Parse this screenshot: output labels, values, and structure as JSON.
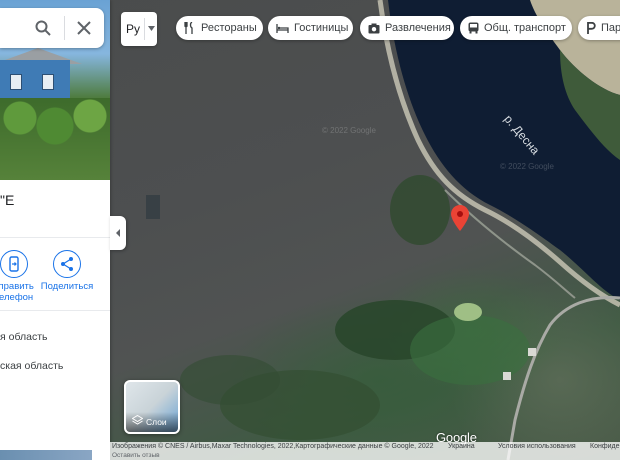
{
  "search": {
    "search_icon": "search-icon",
    "close_icon": "close-icon"
  },
  "place": {
    "title_fragment": "\"E",
    "actions": [
      {
        "label": "тправить\nтелефон",
        "icon": "phone-send-icon"
      },
      {
        "label": "Поделиться",
        "icon": "share-icon"
      }
    ],
    "regions": [
      "я область",
      "ская область"
    ]
  },
  "toolbar": {
    "language_value": "Ру",
    "chips": [
      {
        "label": "Рестораны",
        "icon": "restaurant-icon"
      },
      {
        "label": "Гостиницы",
        "icon": "hotel-icon"
      },
      {
        "label": "Развлечения",
        "icon": "camera-icon"
      },
      {
        "label": "Общ. транспорт",
        "icon": "bus-icon"
      },
      {
        "label": "Парк",
        "icon": "parking-icon"
      }
    ]
  },
  "map": {
    "river_label": "р. Десна",
    "watermark": "© 2022 Google",
    "layers_label": "Слои",
    "logo": "Google",
    "pin_color": "#ea4335"
  },
  "footer": {
    "attribution": "Изображения © CNES / Airbus,Maxar Technologies, 2022,Картографические данные © Google, 2022",
    "country": "Украина",
    "terms": "Условия использования",
    "privacy": "Конфиде",
    "feedback": "Оставить отзыв"
  }
}
